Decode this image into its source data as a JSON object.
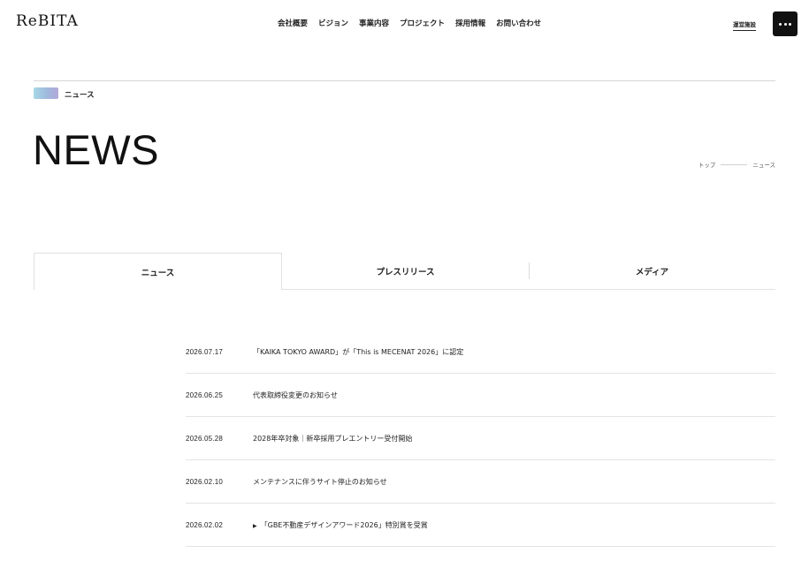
{
  "header": {
    "logo_text": "ReBITA",
    "nav": [
      {
        "label": "会社概要"
      },
      {
        "label": "ビジョン"
      },
      {
        "label": "事業内容"
      },
      {
        "label": "プロジェクト"
      },
      {
        "label": "採用情報"
      },
      {
        "label": "お問い合わせ"
      }
    ],
    "facility_link": "運営施設",
    "menu_icon": "more-dots-icon"
  },
  "page": {
    "section_label": "ニュース",
    "title": "NEWS",
    "breadcrumb": [
      "トップ",
      "ニュース"
    ]
  },
  "tabs": [
    {
      "label": "ニュース",
      "active": true
    },
    {
      "label": "プレスリリース",
      "active": false
    },
    {
      "label": "メディア",
      "active": false
    }
  ],
  "news": [
    {
      "date": "2026.07.17",
      "title": "「KAIKA TOKYO AWARD」が「This is MECENAT 2026」に認定",
      "marker": ""
    },
    {
      "date": "2026.06.25",
      "title": "代表取締役変更のお知らせ",
      "marker": ""
    },
    {
      "date": "2026.05.28",
      "title": "2028年卒対象｜新卒採用プレエントリー受付開始",
      "marker": ""
    },
    {
      "date": "2026.02.10",
      "title": "メンテナンスに伴うサイト停止のお知らせ",
      "marker": ""
    },
    {
      "date": "2026.02.02",
      "title": "「GBE不動産デザインアワード2026」特別賞を受賞",
      "marker": "▶"
    }
  ],
  "colors": {
    "accent_gradient": [
      "#a6d8e6",
      "#9fb8dc",
      "#b2a8d8"
    ],
    "menu_button": "#111111"
  }
}
